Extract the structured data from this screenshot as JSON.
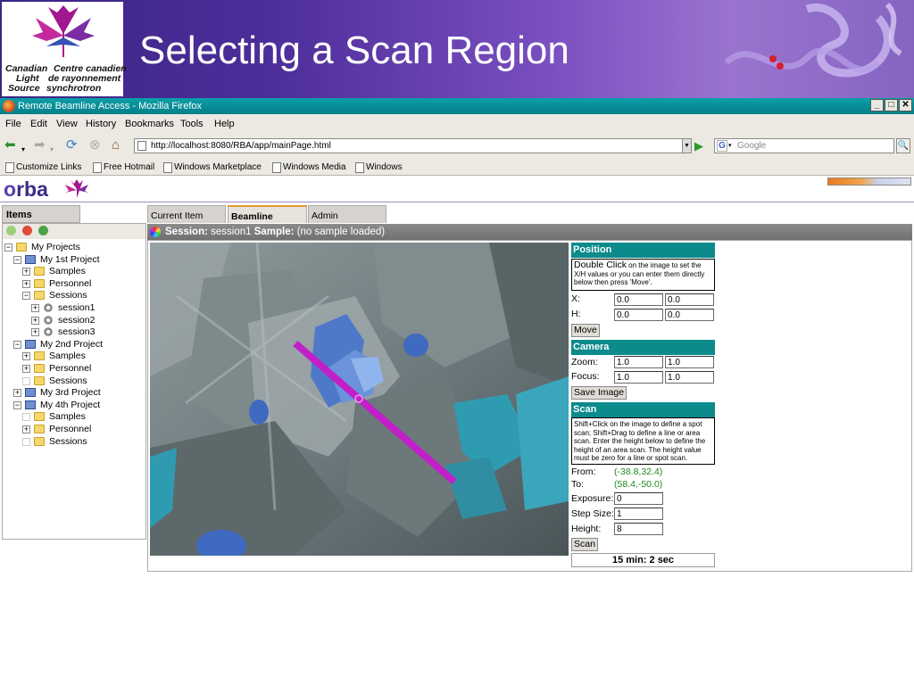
{
  "slide_title": "Selecting a Scan Region",
  "logo": {
    "line1_en": "Canadian",
    "line1_fr": "Centre canadien",
    "line2_en": "Light",
    "line2_fr": "de rayonnement",
    "line3_en": "Source",
    "line3_fr": "synchrotron"
  },
  "window": {
    "title": "Remote Beamline Access - Mozilla Firefox",
    "minimize": "_",
    "maximize": "□",
    "close": "✕"
  },
  "menu": [
    "File",
    "Edit",
    "View",
    "History",
    "Bookmarks",
    "Tools",
    "Help"
  ],
  "nav": {
    "url": "http://localhost:8080/RBA/app/mainPage.html",
    "search_placeholder": "Google",
    "search_engine_icon": "G"
  },
  "bookmarks": [
    "Customize Links",
    "Free Hotmail",
    "Windows Marketplace",
    "Windows Media",
    "Windows"
  ],
  "app": {
    "logo": "rba",
    "logo_prefix": "o"
  },
  "left_panel": {
    "tab": "Items",
    "tree": [
      {
        "label": "My Projects",
        "exp": "−",
        "icon": "folder"
      },
      {
        "label": "My 1st Project",
        "exp": "−",
        "icon": "book"
      },
      {
        "label": "Samples",
        "exp": "+",
        "icon": "folder"
      },
      {
        "label": "Personnel",
        "exp": "+",
        "icon": "folder"
      },
      {
        "label": "Sessions",
        "exp": "−",
        "icon": "folder"
      },
      {
        "label": "session1",
        "exp": "+",
        "icon": "gear"
      },
      {
        "label": "session2",
        "exp": "+",
        "icon": "gear"
      },
      {
        "label": "session3",
        "exp": "+",
        "icon": "gear"
      },
      {
        "label": "My 2nd Project",
        "exp": "−",
        "icon": "book"
      },
      {
        "label": "Samples",
        "exp": "+",
        "icon": "folder"
      },
      {
        "label": "Personnel",
        "exp": "+",
        "icon": "folder"
      },
      {
        "label": "Sessions",
        "exp": "",
        "icon": "folder"
      },
      {
        "label": "My 3rd Project",
        "exp": "+",
        "icon": "book"
      },
      {
        "label": "My 4th Project",
        "exp": "−",
        "icon": "book"
      },
      {
        "label": "Samples",
        "exp": "",
        "icon": "folder"
      },
      {
        "label": "Personnel",
        "exp": "+",
        "icon": "folder"
      },
      {
        "label": "Sessions",
        "exp": "",
        "icon": "folder"
      }
    ]
  },
  "tabs": {
    "current_item": "Current Item",
    "beamline": "Beamline",
    "admin": "Admin"
  },
  "session": {
    "session_label": "Session:",
    "session_value": "session1",
    "sample_label": "Sample:",
    "sample_value": "(no sample loaded)"
  },
  "position": {
    "header": "Position",
    "info_big": "Double Click",
    "info_rest": " on the image to set the X/H values or you can enter them directly below then press 'Move'.",
    "x_label": "X:",
    "x1": "0.0",
    "x2": "0.0",
    "h_label": "H:",
    "h1": "0.0",
    "h2": "0.0",
    "move": "Move"
  },
  "camera": {
    "header": "Camera",
    "zoom_label": "Zoom:",
    "zoom1": "1.0",
    "zoom2": "1.0",
    "focus_label": "Focus:",
    "focus1": "1.0",
    "focus2": "1.0",
    "save": "Save Image"
  },
  "scan": {
    "header": "Scan",
    "info": "Shift+Click on the image to define a spot scan; Shift+Drag to define a line or area scan. Enter the height below to define the height of an area scan. The height value must be zero for a line or spot scan.",
    "from_label": "From:",
    "from_value": "(-38.8,32.4)",
    "to_label": "To:",
    "to_value": "(58.4,-50.0)",
    "exposure_label": "Exposure:",
    "exposure": "0",
    "step_label": "Step Size:",
    "step": "1",
    "height_label": "Height:",
    "height": "8",
    "scan_btn": "Scan",
    "timer": "15 min: 2 sec"
  },
  "colors": {
    "teal_header": "#0c8a8c",
    "scan_line": "#c21fc9",
    "banner": "#4d2e9a"
  }
}
